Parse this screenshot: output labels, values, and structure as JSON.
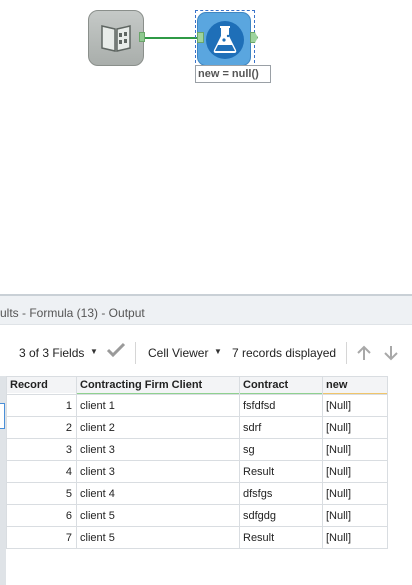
{
  "canvas": {
    "input_tool_icon": "book-input-icon",
    "formula_tool_icon": "flask-formula-icon",
    "annotation": "new = null()"
  },
  "results": {
    "title": "ults - Formula (13) - Output",
    "fields_label": "3 of 3 Fields",
    "cell_viewer_label": "Cell Viewer",
    "records_label": "7 records displayed",
    "columns": [
      "Record",
      "Contracting Firm Client",
      "Contract",
      "new"
    ],
    "column_colors": [
      "#ffffff",
      "#8fd18f",
      "#8fd18f",
      "#f0c56a"
    ],
    "rows": [
      {
        "record": "1",
        "client": "client 1",
        "contract": "fsfdfsd",
        "new": "[Null]"
      },
      {
        "record": "2",
        "client": "client 2",
        "contract": "sdrf",
        "new": "[Null]"
      },
      {
        "record": "3",
        "client": "client 3",
        "contract": "sg",
        "new": "[Null]"
      },
      {
        "record": "4",
        "client": "client 3",
        "contract": "Result",
        "new": "[Null]"
      },
      {
        "record": "5",
        "client": "client 4",
        "contract": "dfsfgs",
        "new": "[Null]"
      },
      {
        "record": "6",
        "client": "client 5",
        "contract": "sdfgdg",
        "new": "[Null]"
      },
      {
        "record": "7",
        "client": "client 5",
        "contract": "Result",
        "new": "[Null]"
      }
    ]
  }
}
